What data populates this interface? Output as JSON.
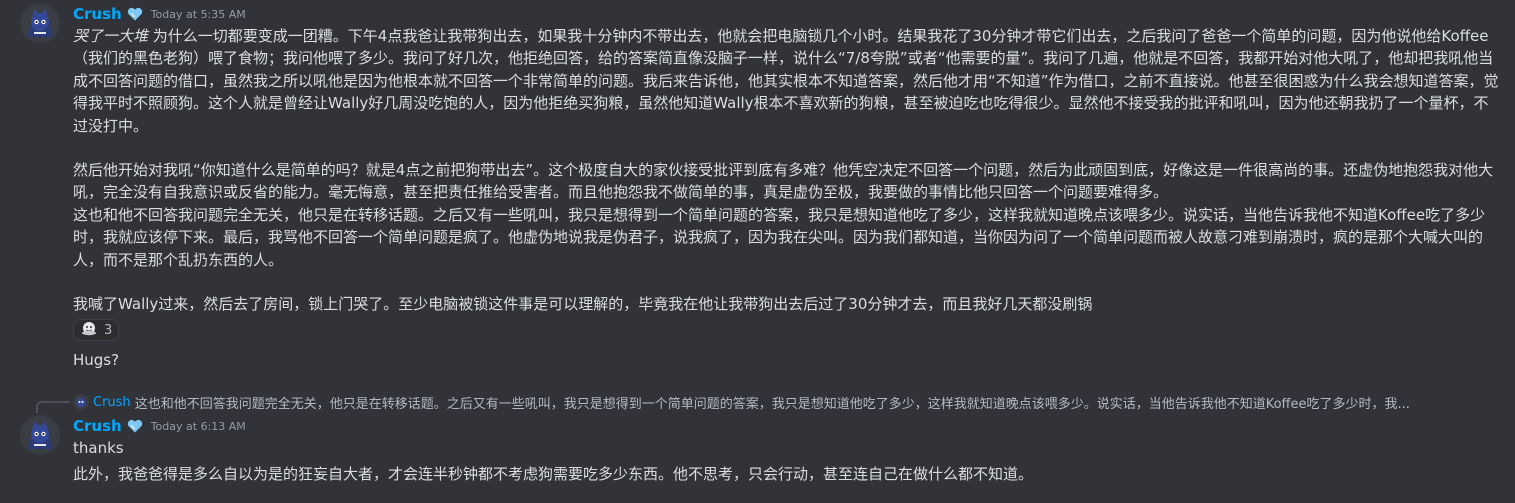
{
  "colors": {
    "background": "#313338",
    "username": "#00a8fc",
    "text": "#dbdee1",
    "muted": "#949ba4"
  },
  "msg1": {
    "username": "Crush",
    "badge_icon": "heart-icon",
    "timestamp": "Today at 5:35 AM",
    "p1_italic": "哭了一大堆",
    "p1_rest": "为什么一切都要变成一团糟。下午4点我爸让我带狗出去，如果我十分钟内不带出去，他就会把电脑锁几个小时。结果我花了30分钟才带它们出去，之后我问了爸爸一个简单的问题，因为他说他给Koffee（我们的黑色老狗）喂了食物；我问他喂了多少。我问了好几次，他拒绝回答，给的答案简直像没脑子一样，说什么“7/8夸脱”或者“他需要的量”。我问了几遍，他就是不回答，我都开始对他大吼了，他却把我吼他当成不回答问题的借口，虽然我之所以吼他是因为他根本就不回答一个非常简单的问题。我后来告诉他，他其实根本不知道答案，然后他才用“不知道”作为借口，之前不直接说。他甚至很困惑为什么我会想知道答案，觉得我平时不照顾狗。这个人就是曾经让Wally好几周没吃饱的人，因为他拒绝买狗粮，虽然他知道Wally根本不喜欢新的狗粮，甚至被迫吃也吃得很少。显然他不接受我的批评和吼叫，因为他还朝我扔了一个量杯，不过没打中。",
    "p2": "然后他开始对我吼“你知道什么是简单的吗？就是4点之前把狗带出去”。这个极度自大的家伙接受批评到底有多难？他凭空决定不回答一个问题，然后为此顽固到底，好像这是一件很高尚的事。还虚伪地抱怨我对他大吼，完全没有自我意识或反省的能力。毫无悔意，甚至把责任推给受害者。而且他抱怨我不做简单的事，真是虚伪至极，我要做的事情比他只回答一个问题要难得多。",
    "p3": "这也和他不回答我问题完全无关，他只是在转移话题。之后又有一些吼叫，我只是想得到一个简单问题的答案，我只是想知道他吃了多少，这样我就知道晚点该喂多少。说实话，当他告诉我他不知道Koffee吃了多少时，我就应该停下来。最后，我骂他不回答一个简单问题是疯了。他虚伪地说我是伪君子，说我疯了，因为我在尖叫。因为我们都知道，当你因为问了一个简单问题而被人故意刁难到崩溃时，疯的是那个大喊大叫的人，而不是那个乱扔东西的人。",
    "p4": "我喊了Wally过来，然后去了房间，锁上门哭了。至少电脑被锁这件事是可以理解的，毕竟我在他让我带狗出去后过了30分钟才去，而且我好几天都没刷锅",
    "reaction_icon": "hug-emoji-icon",
    "reaction_count": "3",
    "followup": "Hugs?"
  },
  "msg2": {
    "reply_username": "Crush",
    "reply_text": "这也和他不回答我问题完全无关，他只是在转移话题。之后又有一些吼叫，我只是想得到一个简单问题的答案，我只是想知道他吃了多少，这样我就知道晚点该喂多少。说实话，当他告诉我他不知道Koffee吃了多少时，我...",
    "username": "Crush",
    "badge_icon": "heart-icon",
    "timestamp": "Today at 6:13 AM",
    "line1": "thanks",
    "line2": "此外，我爸爸得是多么自以为是的狂妄自大者，才会连半秒钟都不考虑狗需要吃多少东西。他不思考，只会行动，甚至连自己在做什么都不知道。"
  }
}
